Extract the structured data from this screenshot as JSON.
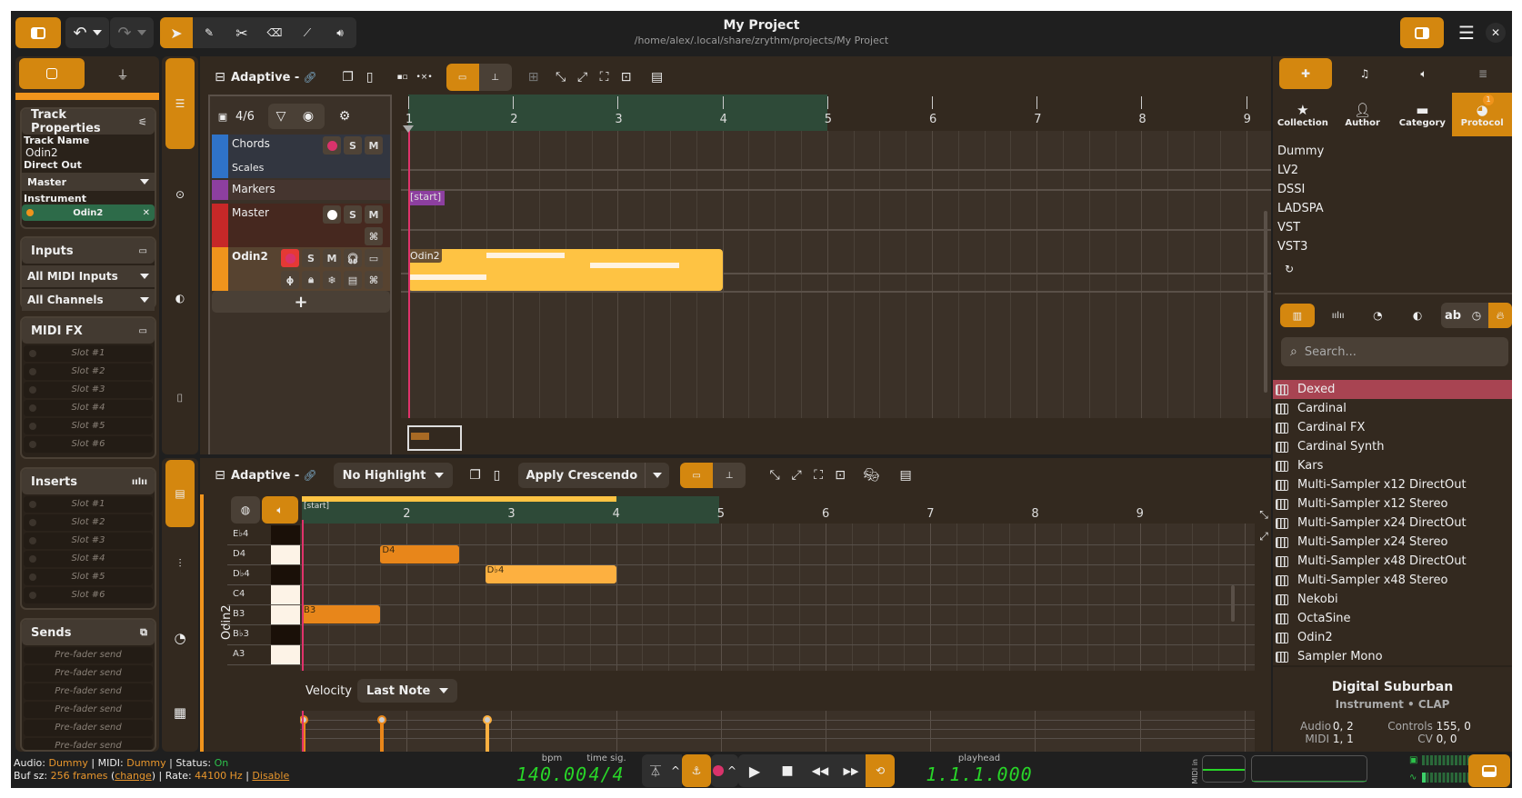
{
  "header": {
    "title": "My Project",
    "path": "/home/alex/.local/share/zrythm/projects/My Project",
    "toolbar_tools": [
      "select-tool",
      "pencil-tool",
      "cut-tool",
      "eraser-tool",
      "ramp-tool",
      "audition-tool"
    ],
    "active_tool": "select-tool"
  },
  "left_panel": {
    "tabs": [
      "track-inspector",
      "plugin-inspector"
    ],
    "track_properties": {
      "title": "Track Properties",
      "track_name_label": "Track Name",
      "track_name": "Odin2",
      "direct_out_label": "Direct Out",
      "direct_out": "Master",
      "instrument_label": "Instrument",
      "instrument": "Odin2"
    },
    "inputs": {
      "title": "Inputs",
      "midi_inputs": "All MIDI Inputs",
      "channels": "All Channels"
    },
    "midi_fx": {
      "title": "MIDI FX",
      "slots": [
        "Slot #1",
        "Slot #2",
        "Slot #3",
        "Slot #4",
        "Slot #5",
        "Slot #6"
      ]
    },
    "inserts": {
      "title": "Inserts",
      "slots": [
        "Slot #1",
        "Slot #2",
        "Slot #3",
        "Slot #4",
        "Slot #5",
        "Slot #6"
      ]
    },
    "sends": {
      "title": "Sends",
      "slots": [
        "Pre-fader send",
        "Pre-fader send",
        "Pre-fader send",
        "Pre-fader send",
        "Pre-fader send",
        "Pre-fader send"
      ]
    }
  },
  "timeline": {
    "snap_label": "Adaptive -",
    "track_count": "4/6",
    "ruler_bars": [
      "1",
      "2",
      "3",
      "4",
      "5",
      "6",
      "7",
      "8",
      "9"
    ],
    "loop_start_bar": 1,
    "loop_end_bar": 5,
    "tracks": [
      {
        "name": "Chords",
        "sub": "Scales",
        "color": "#2f73c8",
        "buttons": [
          "S",
          "M"
        ]
      },
      {
        "name": "Markers",
        "color": "#8d3fa0"
      },
      {
        "name": "Master",
        "color": "#c62828",
        "buttons": [
          "S",
          "M"
        ]
      },
      {
        "name": "Odin2",
        "color": "#f0941c",
        "buttons": [
          "S",
          "M"
        ]
      }
    ],
    "marker_label": "[start]",
    "region_label": "Odin2",
    "region_start_bar": 1,
    "region_end_bar": 4
  },
  "editor": {
    "snap_label": "Adaptive -",
    "highlight": "No Highlight",
    "velocity_action": "Apply Crescendo",
    "ruler_bars": [
      "2",
      "3",
      "4",
      "5",
      "6",
      "7",
      "8",
      "9"
    ],
    "marker_label": "[start]",
    "track_label": "Odin2",
    "keys": [
      {
        "label": "E♭4",
        "black": true
      },
      {
        "label": "D4",
        "black": false
      },
      {
        "label": "D♭4",
        "black": true
      },
      {
        "label": "C4",
        "black": false
      },
      {
        "label": "B3",
        "black": false
      },
      {
        "label": "B♭3",
        "black": true
      },
      {
        "label": "A3",
        "black": false
      }
    ],
    "notes": [
      {
        "label": "D4",
        "pitch_row": 1,
        "start": 1.75,
        "end": 2.5,
        "color": "#e8861a"
      },
      {
        "label": "D♭4",
        "pitch_row": 2,
        "start": 2.75,
        "end": 4.0,
        "color": "#fdb040"
      },
      {
        "label": "B3",
        "pitch_row": 4,
        "start": 1.0,
        "end": 1.75,
        "color": "#e8861a"
      }
    ],
    "velocity_label": "Velocity",
    "velocity_mode": "Last Note"
  },
  "right_panel": {
    "filter_tabs": [
      "Collection",
      "Author",
      "Category",
      "Protocol"
    ],
    "active_filter": "Protocol",
    "protocol_badge": "1",
    "protocols": [
      "Dummy",
      "LV2",
      "DSSI",
      "LADSPA",
      "VST",
      "VST3"
    ],
    "search_placeholder": "Search...",
    "plugins": [
      "Dexed",
      "Cardinal",
      "Cardinal FX",
      "Cardinal Synth",
      "Kars",
      "Multi-Sampler x12 DirectOut",
      "Multi-Sampler x12 Stereo",
      "Multi-Sampler x24 DirectOut",
      "Multi-Sampler x24 Stereo",
      "Multi-Sampler x48 DirectOut",
      "Multi-Sampler x48 Stereo",
      "Nekobi",
      "OctaSine",
      "Odin2",
      "Sampler Mono"
    ],
    "selected_plugin": "Dexed",
    "info": {
      "name": "Digital Suburban",
      "type": "Instrument • CLAP",
      "audio_label": "Audio",
      "audio": "0, 2",
      "midi_label": "MIDI",
      "midi": "1, 1",
      "controls_label": "Controls",
      "controls": "155, 0",
      "cv_label": "CV",
      "cv": "0, 0"
    }
  },
  "status": {
    "audio_label": "Audio:",
    "audio": "Dummy",
    "midi_label": "MIDI:",
    "midi": "Dummy",
    "status_label": "Status:",
    "status": "On",
    "buf_label": "Buf sz:",
    "buf": "256 frames",
    "change": "change",
    "rate_label": "Rate:",
    "rate": "44100 Hz",
    "disable": "Disable"
  },
  "transport": {
    "bpm_label": "bpm",
    "bpm": "140.00",
    "timesig_label": "time sig.",
    "timesig": "4/4",
    "playhead_label": "playhead",
    "playhead": "1.1.1.000",
    "midi_in_label": "MIDI in"
  },
  "colors": {
    "accent": "#d4870f",
    "playhead": "#e0326b",
    "region": "#fec343",
    "lcd": "#28d528"
  }
}
